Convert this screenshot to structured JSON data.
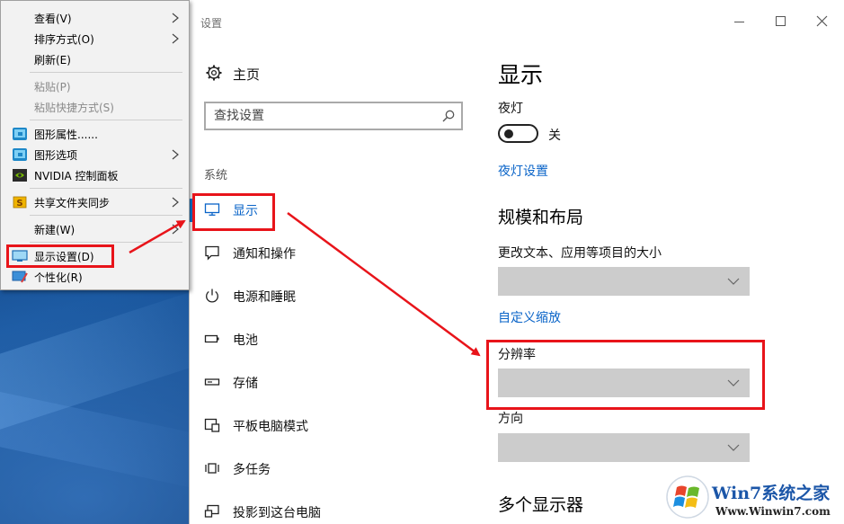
{
  "window": {
    "title": "设置"
  },
  "nav": {
    "home_label": "主页",
    "search_placeholder": "查找设置",
    "section_label": "系统",
    "items": [
      {
        "label": "显示",
        "icon": "monitor-icon",
        "active": true
      },
      {
        "label": "通知和操作",
        "icon": "message-icon",
        "active": false
      },
      {
        "label": "电源和睡眠",
        "icon": "power-icon",
        "active": false
      },
      {
        "label": "电池",
        "icon": "battery-icon",
        "active": false
      },
      {
        "label": "存储",
        "icon": "storage-drive-icon",
        "active": false
      },
      {
        "label": "平板电脑模式",
        "icon": "tablet-mode-icon",
        "active": false
      },
      {
        "label": "多任务",
        "icon": "multitask-icon",
        "active": false
      },
      {
        "label": "投影到这台电脑",
        "icon": "project-icon",
        "active": false
      }
    ]
  },
  "content": {
    "page_title": "显示",
    "night_light_label": "夜灯",
    "night_light_state": "关",
    "night_light_link": "夜灯设置",
    "scale_heading": "规模和布局",
    "scale_label": "更改文本、应用等项目的大小",
    "scale_value": "",
    "custom_scale_link": "自定义缩放",
    "resolution_label": "分辨率",
    "resolution_value": "",
    "orientation_label": "方向",
    "orientation_value": "",
    "multi_display_heading": "多个显示器"
  },
  "context_menu": {
    "items": [
      {
        "label": "查看(V)",
        "submenu": true,
        "disabled": false
      },
      {
        "label": "排序方式(O)",
        "submenu": true,
        "disabled": false
      },
      {
        "label": "刷新(E)",
        "submenu": false,
        "disabled": false
      },
      {
        "label": "粘贴(P)",
        "submenu": false,
        "disabled": true
      },
      {
        "label": "粘贴快捷方式(S)",
        "submenu": false,
        "disabled": true
      },
      {
        "label": "图形属性......",
        "submenu": false,
        "disabled": false,
        "icon": "intel-graphics-icon"
      },
      {
        "label": "图形选项",
        "submenu": true,
        "disabled": false,
        "icon": "intel-graphics-icon"
      },
      {
        "label": "NVIDIA 控制面板",
        "submenu": false,
        "disabled": false,
        "icon": "nvidia-icon"
      },
      {
        "label": "共享文件夹同步",
        "submenu": true,
        "disabled": false,
        "icon": "sync-folder-icon"
      },
      {
        "label": "新建(W)",
        "submenu": true,
        "disabled": false
      },
      {
        "label": "显示设置(D)",
        "submenu": false,
        "disabled": false,
        "icon": "display-settings-icon"
      },
      {
        "label": "个性化(R)",
        "submenu": false,
        "disabled": false,
        "icon": "personalize-icon"
      }
    ]
  },
  "annotations": {
    "highlight_color": "#e8141a"
  },
  "watermark": {
    "brand": "Win7系统之家",
    "site": "Www.Winwin7.com"
  },
  "colors": {
    "accent": "#0078d7",
    "link": "#0a64c8",
    "dropdown_bg": "#cccccc"
  }
}
